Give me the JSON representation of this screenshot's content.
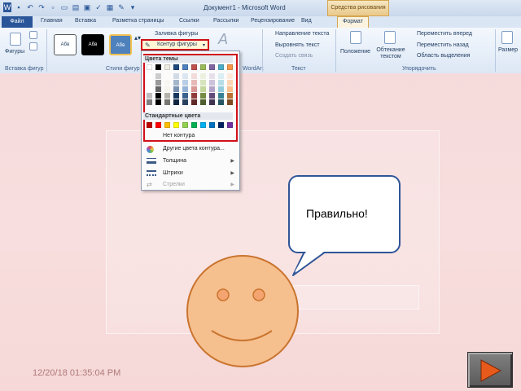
{
  "window": {
    "title": "Документ1 - Microsoft Word",
    "context_tab": "Средства рисования"
  },
  "tabs": [
    {
      "label": "Файл"
    },
    {
      "label": "Главная"
    },
    {
      "label": "Вставка"
    },
    {
      "label": "Разметка страницы"
    },
    {
      "label": "Ссылки"
    },
    {
      "label": "Рассылки"
    },
    {
      "label": "Рецензирование"
    },
    {
      "label": "Вид"
    },
    {
      "label": "Формат"
    }
  ],
  "ribbon": {
    "shapes_label": "Фигуры",
    "insert_shapes_group": "Вставка фигур",
    "shape_styles_group": "Стили фигур",
    "style_boxes": [
      "Абв",
      "Абв",
      "Абв"
    ],
    "fill_button": "Заливка фигуры",
    "outline_button": "Контур фигуры",
    "text_direction": "Направление текста",
    "align_text": "Выровнять текст",
    "create_link": "Создать связь",
    "text_group": "Текст",
    "position": "Положение",
    "wrap_text": "Обтекание текстом",
    "bring_forward": "Переместить вперед",
    "send_backward": "Переместить назад",
    "selection_pane": "Область выделения",
    "arrange_group": "Упорядочить",
    "size": "Размер",
    "wordart_label": "WordArt"
  },
  "dropdown": {
    "theme_colors_header": "Цвета темы",
    "standard_colors_header": "Стандартные цвета",
    "theme_colors": [
      "#ffffff",
      "#000000",
      "#eeece1",
      "#1f497d",
      "#4f81bd",
      "#c0504d",
      "#9bbb59",
      "#8064a2",
      "#4bacc6",
      "#f79646"
    ],
    "standard_colors": [
      "#c00000",
      "#ff0000",
      "#ffc000",
      "#ffff00",
      "#92d050",
      "#00b050",
      "#00b0f0",
      "#0070c0",
      "#002060",
      "#7030a0"
    ],
    "no_outline": "Нет контура",
    "more_colors": "Другие цвета контура...",
    "weight": "Толщина",
    "dashes": "Штрихи",
    "arrows": "Стрелки"
  },
  "slide": {
    "callout_text": "Правильно!",
    "timestamp": "12/20/18 01:35:04 PM",
    "smiley_color": "#f6bf8e",
    "next_icon": "play-triangle-icon"
  }
}
